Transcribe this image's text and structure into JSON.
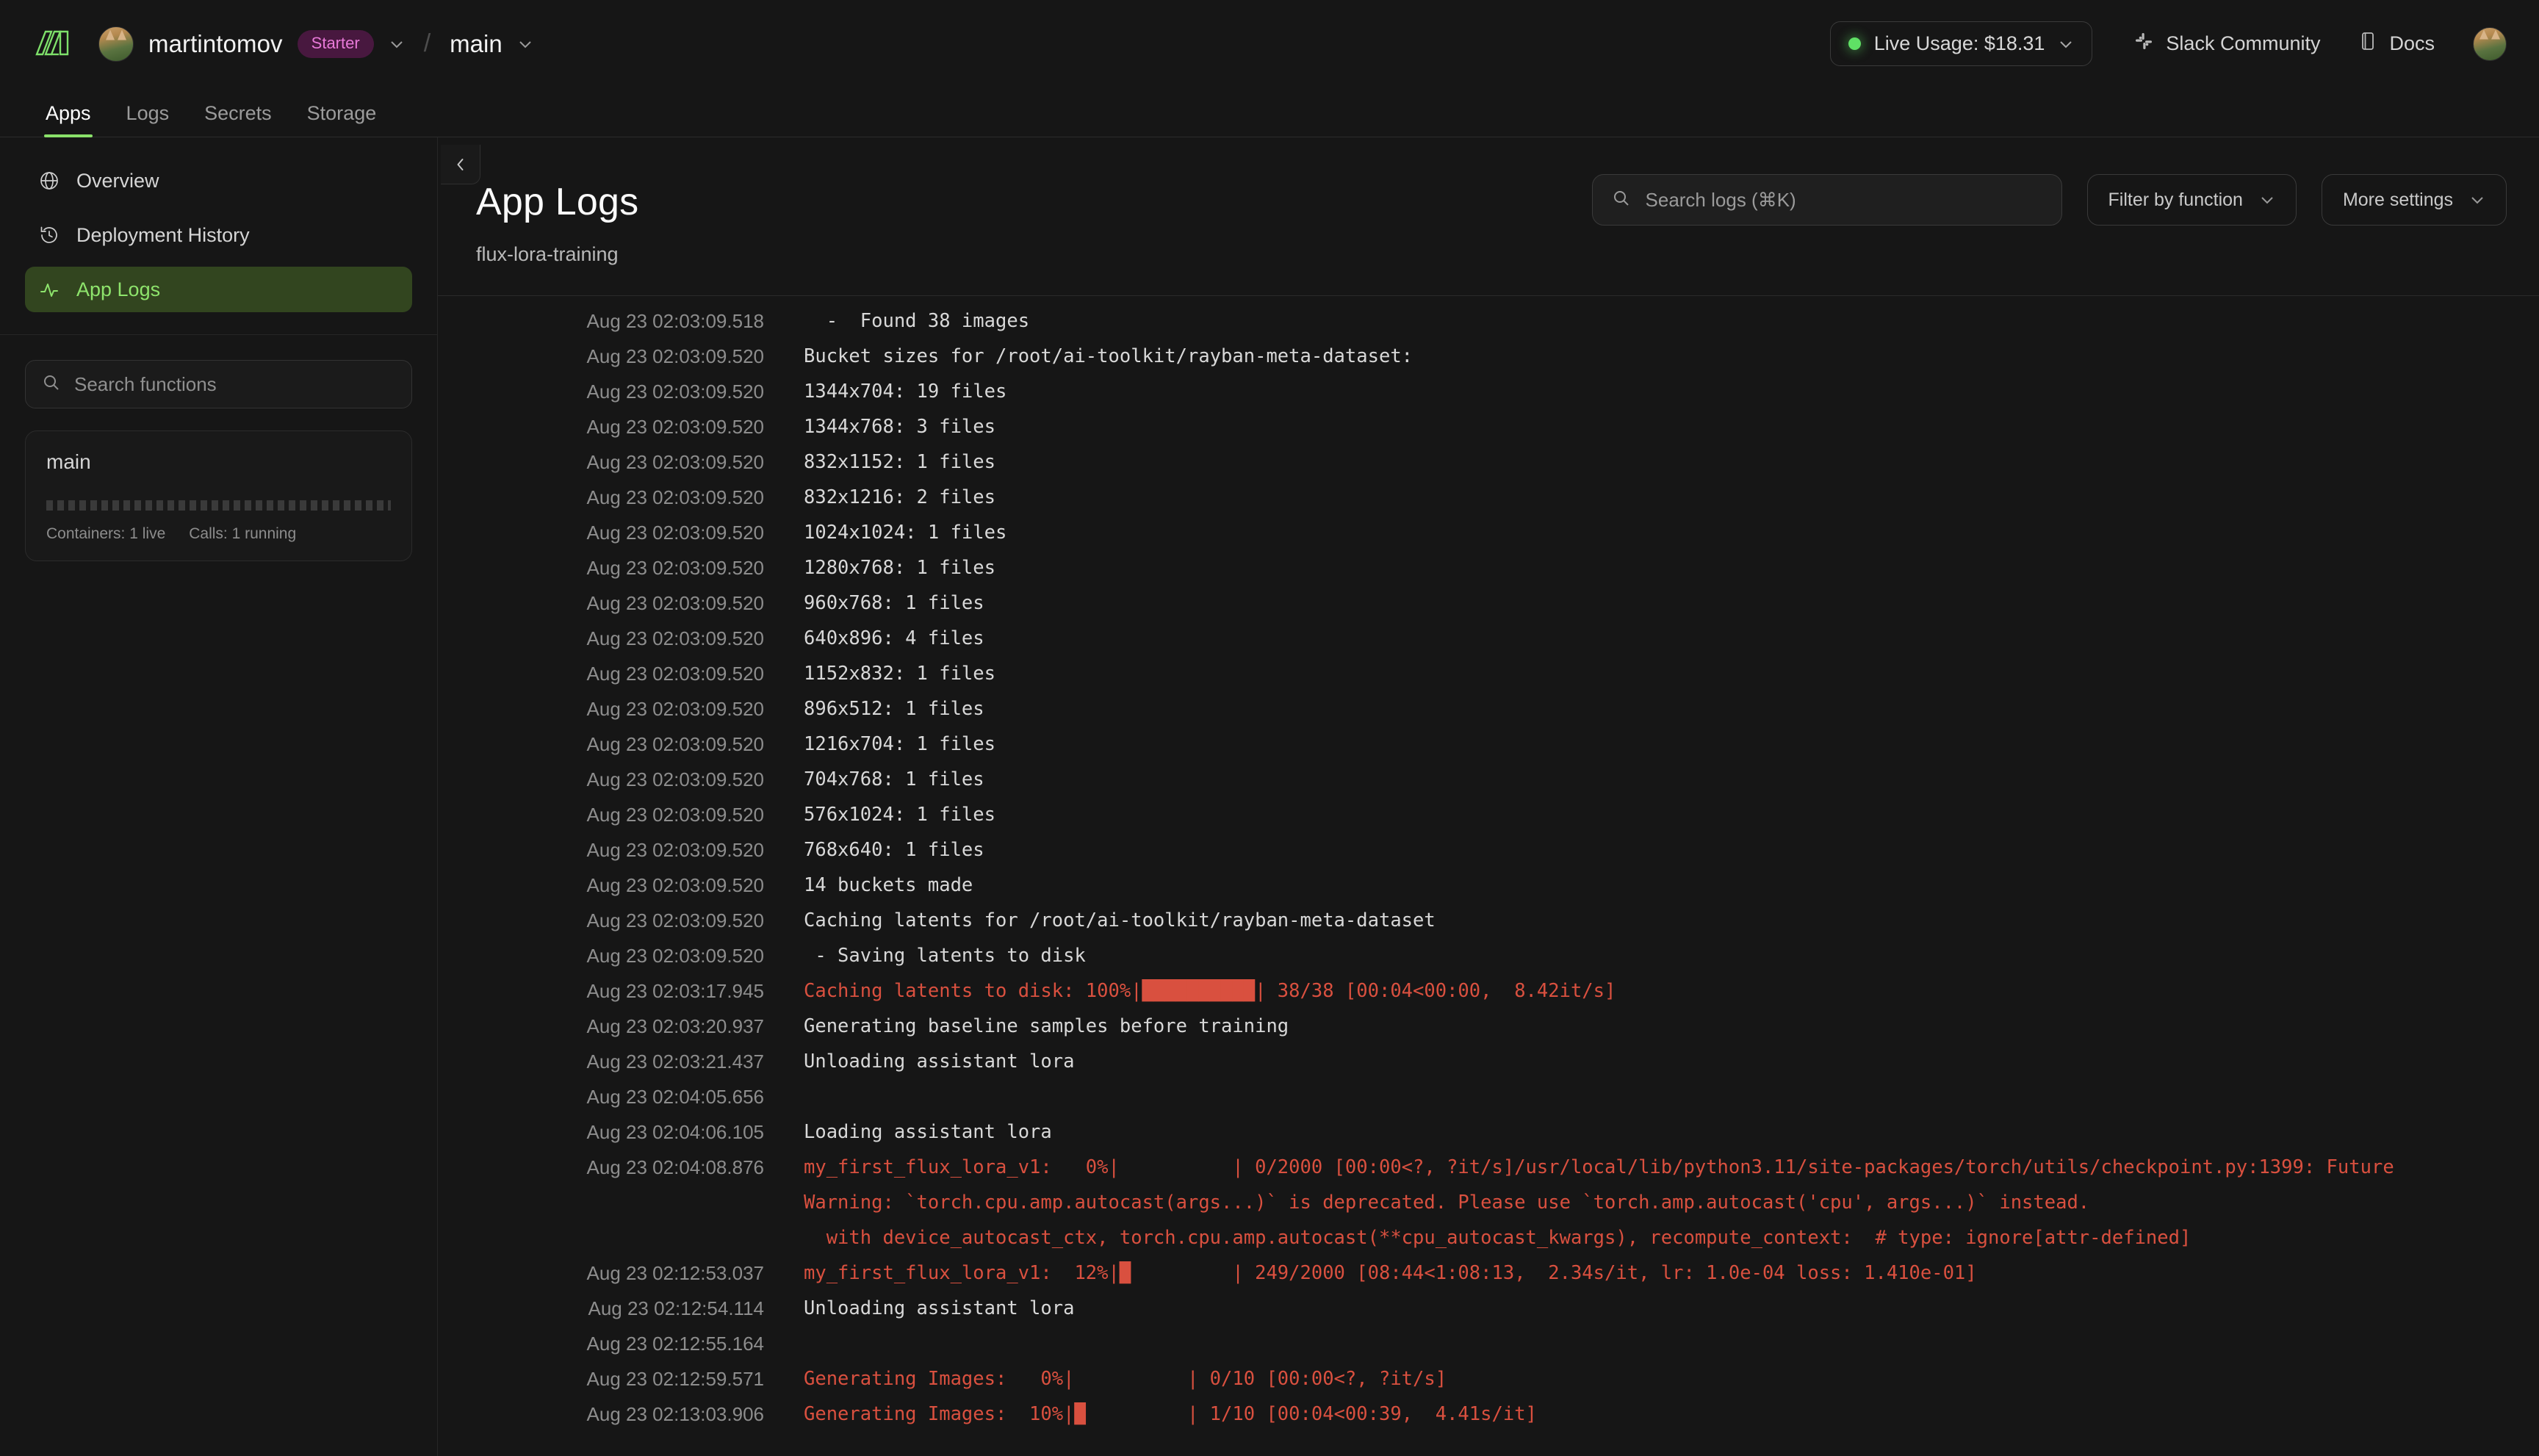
{
  "topbar": {
    "logo_name": "modal-logo",
    "org": "martintomov",
    "plan_badge": "Starter",
    "separator": "/",
    "environment": "main",
    "usage": "Live Usage: $18.31",
    "slack_link": "Slack Community",
    "docs_link": "Docs",
    "accent_green": "#8ae16a",
    "plan_badge_color": "#e879d8"
  },
  "tabs": [
    {
      "label": "Apps",
      "active": true
    },
    {
      "label": "Logs",
      "active": false
    },
    {
      "label": "Secrets",
      "active": false
    },
    {
      "label": "Storage",
      "active": false
    }
  ],
  "sidebar": {
    "items": [
      {
        "label": "Overview",
        "icon": "globe-icon",
        "active": false
      },
      {
        "label": "Deployment History",
        "icon": "history-icon",
        "active": false
      },
      {
        "label": "App Logs",
        "icon": "activity-icon",
        "active": true
      }
    ],
    "search_placeholder": "Search functions",
    "function_card": {
      "name": "main",
      "containers": "Containers: 1 live",
      "calls": "Calls: 1 running"
    }
  },
  "main": {
    "title": "App Logs",
    "subtitle": "flux-lora-training",
    "search_placeholder": "Search logs (⌘K)",
    "filter_label": "Filter by function",
    "settings_label": "More settings"
  },
  "logs": [
    {
      "ts": "Aug 23 02:03:09.518",
      "msg": "  -  Found 38 images",
      "err": false
    },
    {
      "ts": "Aug 23 02:03:09.520",
      "msg": "Bucket sizes for /root/ai-toolkit/rayban-meta-dataset:",
      "err": false
    },
    {
      "ts": "Aug 23 02:03:09.520",
      "msg": "1344x704: 19 files",
      "err": false
    },
    {
      "ts": "Aug 23 02:03:09.520",
      "msg": "1344x768: 3 files",
      "err": false
    },
    {
      "ts": "Aug 23 02:03:09.520",
      "msg": "832x1152: 1 files",
      "err": false
    },
    {
      "ts": "Aug 23 02:03:09.520",
      "msg": "832x1216: 2 files",
      "err": false
    },
    {
      "ts": "Aug 23 02:03:09.520",
      "msg": "1024x1024: 1 files",
      "err": false
    },
    {
      "ts": "Aug 23 02:03:09.520",
      "msg": "1280x768: 1 files",
      "err": false
    },
    {
      "ts": "Aug 23 02:03:09.520",
      "msg": "960x768: 1 files",
      "err": false
    },
    {
      "ts": "Aug 23 02:03:09.520",
      "msg": "640x896: 4 files",
      "err": false
    },
    {
      "ts": "Aug 23 02:03:09.520",
      "msg": "1152x832: 1 files",
      "err": false
    },
    {
      "ts": "Aug 23 02:03:09.520",
      "msg": "896x512: 1 files",
      "err": false
    },
    {
      "ts": "Aug 23 02:03:09.520",
      "msg": "1216x704: 1 files",
      "err": false
    },
    {
      "ts": "Aug 23 02:03:09.520",
      "msg": "704x768: 1 files",
      "err": false
    },
    {
      "ts": "Aug 23 02:03:09.520",
      "msg": "576x1024: 1 files",
      "err": false
    },
    {
      "ts": "Aug 23 02:03:09.520",
      "msg": "768x640: 1 files",
      "err": false
    },
    {
      "ts": "Aug 23 02:03:09.520",
      "msg": "14 buckets made",
      "err": false
    },
    {
      "ts": "Aug 23 02:03:09.520",
      "msg": "Caching latents for /root/ai-toolkit/rayban-meta-dataset",
      "err": false
    },
    {
      "ts": "Aug 23 02:03:09.520",
      "msg": " - Saving latents to disk",
      "err": false
    },
    {
      "ts": "Aug 23 02:03:17.945",
      "msg": "Caching latents to disk: 100%|██████████| 38/38 [00:04<00:00,  8.42it/s]",
      "err": true
    },
    {
      "ts": "Aug 23 02:03:20.937",
      "msg": "Generating baseline samples before training",
      "err": false
    },
    {
      "ts": "Aug 23 02:03:21.437",
      "msg": "Unloading assistant lora",
      "err": false
    },
    {
      "ts": "Aug 23 02:04:05.656",
      "msg": "",
      "err": false
    },
    {
      "ts": "Aug 23 02:04:06.105",
      "msg": "Loading assistant lora",
      "err": false
    },
    {
      "ts": "Aug 23 02:04:08.876",
      "msg": "my_first_flux_lora_v1:   0%|          | 0/2000 [00:00<?, ?it/s]/usr/local/lib/python3.11/site-packages/torch/utils/checkpoint.py:1399: Future\nWarning: `torch.cpu.amp.autocast(args...)` is deprecated. Please use `torch.amp.autocast('cpu', args...)` instead.\n  with device_autocast_ctx, torch.cpu.amp.autocast(**cpu_autocast_kwargs), recompute_context:  # type: ignore[attr-defined]",
      "err": true
    },
    {
      "ts": "Aug 23 02:12:53.037",
      "msg": "my_first_flux_lora_v1:  12%|█         | 249/2000 [08:44<1:08:13,  2.34s/it, lr: 1.0e-04 loss: 1.410e-01]",
      "err": true
    },
    {
      "ts": "Aug 23 02:12:54.114",
      "msg": "Unloading assistant lora",
      "err": false
    },
    {
      "ts": "Aug 23 02:12:55.164",
      "msg": "",
      "err": false
    },
    {
      "ts": "Aug 23 02:12:59.571",
      "msg": "Generating Images:   0%|          | 0/10 [00:00<?, ?it/s]",
      "err": true
    },
    {
      "ts": "Aug 23 02:13:03.906",
      "msg": "Generating Images:  10%|█         | 1/10 [00:04<00:39,  4.41s/it]",
      "err": true
    }
  ]
}
